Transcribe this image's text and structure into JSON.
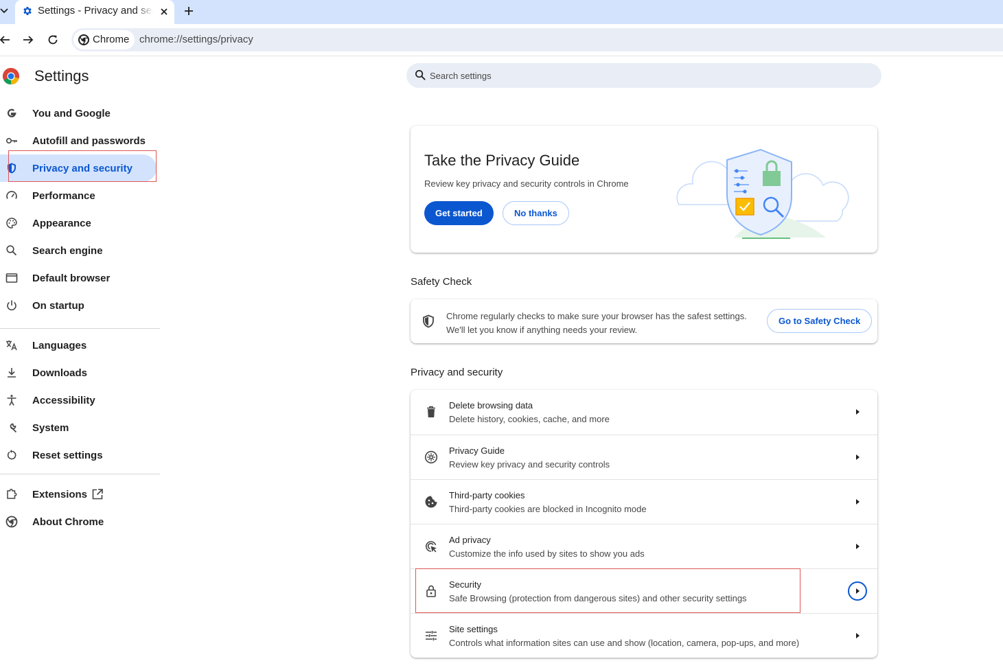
{
  "browser": {
    "tab_title": "Settings - Privacy and security",
    "chip_label": "Chrome",
    "url": "chrome://settings/privacy"
  },
  "settings": {
    "title": "Settings",
    "search_placeholder": "Search settings"
  },
  "sidebar": {
    "items": [
      {
        "label": "You and Google",
        "icon": "google-g-icon"
      },
      {
        "label": "Autofill and passwords",
        "icon": "key-icon"
      },
      {
        "label": "Privacy and security",
        "icon": "shield-icon",
        "active": true
      },
      {
        "label": "Performance",
        "icon": "speedometer-icon"
      },
      {
        "label": "Appearance",
        "icon": "palette-icon"
      },
      {
        "label": "Search engine",
        "icon": "search-icon"
      },
      {
        "label": "Default browser",
        "icon": "browser-window-icon"
      },
      {
        "label": "On startup",
        "icon": "power-icon"
      },
      {
        "label": "Languages",
        "icon": "translate-icon"
      },
      {
        "label": "Downloads",
        "icon": "download-icon"
      },
      {
        "label": "Accessibility",
        "icon": "accessibility-icon"
      },
      {
        "label": "System",
        "icon": "wrench-icon"
      },
      {
        "label": "Reset settings",
        "icon": "reset-icon"
      },
      {
        "label": "Extensions",
        "icon": "puzzle-icon"
      },
      {
        "label": "About Chrome",
        "icon": "chrome-icon"
      }
    ]
  },
  "privacy_guide_card": {
    "title": "Take the Privacy Guide",
    "description": "Review key privacy and security controls in Chrome",
    "get_started": "Get started",
    "no_thanks": "No thanks"
  },
  "safety_check": {
    "heading": "Safety Check",
    "line1": "Chrome regularly checks to make sure your browser has the safest settings.",
    "line2": "We'll let you know if anything needs your review.",
    "button": "Go to Safety Check"
  },
  "privacy_section": {
    "heading": "Privacy and security",
    "rows": [
      {
        "title": "Delete browsing data",
        "subtitle": "Delete history, cookies, cache, and more",
        "icon": "trash-icon"
      },
      {
        "title": "Privacy Guide",
        "subtitle": "Review key privacy and security controls",
        "icon": "compass-icon"
      },
      {
        "title": "Third-party cookies",
        "subtitle": "Third-party cookies are blocked in Incognito mode",
        "icon": "cookie-icon"
      },
      {
        "title": "Ad privacy",
        "subtitle": "Customize the info used by sites to show you ads",
        "icon": "ad-privacy-icon"
      },
      {
        "title": "Security",
        "subtitle": "Safe Browsing (protection from dangerous sites) and other security settings",
        "icon": "lock-icon"
      },
      {
        "title": "Site settings",
        "subtitle": "Controls what information sites can use and show (location, camera, pop-ups, and more)",
        "icon": "sliders-icon"
      }
    ]
  },
  "colors": {
    "accent": "#0b57d0",
    "tabstrip": "#d3e3fd",
    "highlight_box": "#e05555"
  }
}
